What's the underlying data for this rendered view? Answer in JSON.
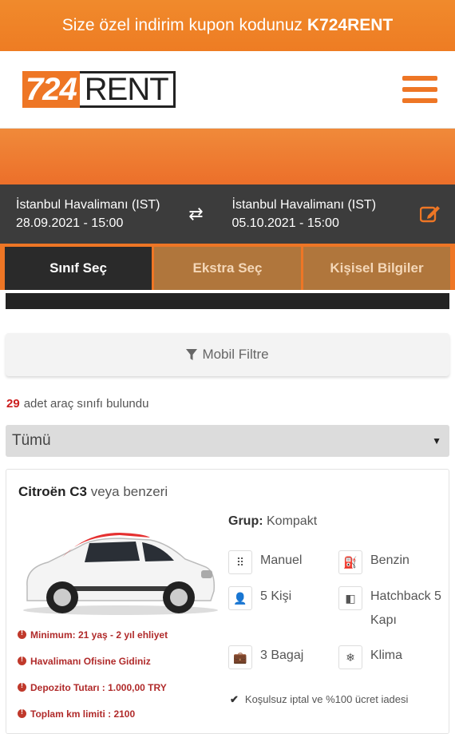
{
  "promo": {
    "text": "Size özel indirim kupon kodunuz",
    "code": "K724RENT"
  },
  "logo": {
    "number": "724",
    "word": "RENT"
  },
  "trip": {
    "pickup_location": "İstanbul Havalimanı (IST)",
    "pickup_datetime": "28.09.2021 - 15:00",
    "return_location": "İstanbul Havalimanı (IST)",
    "return_datetime": "05.10.2021 - 15:00",
    "swap_symbol": "⇄"
  },
  "steps": [
    "Sınıf Seç",
    "Ekstra Seç",
    "Kişisel Bilgiler"
  ],
  "filter": {
    "label": "Mobil Filtre"
  },
  "results": {
    "count": "29",
    "label": "adet araç sınıfı bulundu"
  },
  "select": {
    "value": "Tümü",
    "caret": "▼"
  },
  "car": {
    "name": "Citroën C3",
    "suffix": "veya benzeri",
    "group_label": "Grup:",
    "group_value": "Kompakt",
    "features": {
      "transmission": "Manuel",
      "fuel": "Benzin",
      "passengers": "5 Kişi",
      "body": "Hatchback 5 Kapı",
      "luggage": "3 Bagaj",
      "ac": "Klima"
    },
    "notes": [
      "Minimum: 21 yaş - 2 yıl ehliyet",
      "Havalimanı Ofisine Gidiniz",
      "Depozito Tutarı : 1.000,00 TRY",
      "Toplam km limiti : 2100"
    ],
    "cancel_text": "Koşulsuz iptal ve %100 ücret iadesi"
  },
  "colors": {
    "brand": "#ee7625",
    "dark": "#3c3c3c",
    "alert": "#c0392b"
  }
}
